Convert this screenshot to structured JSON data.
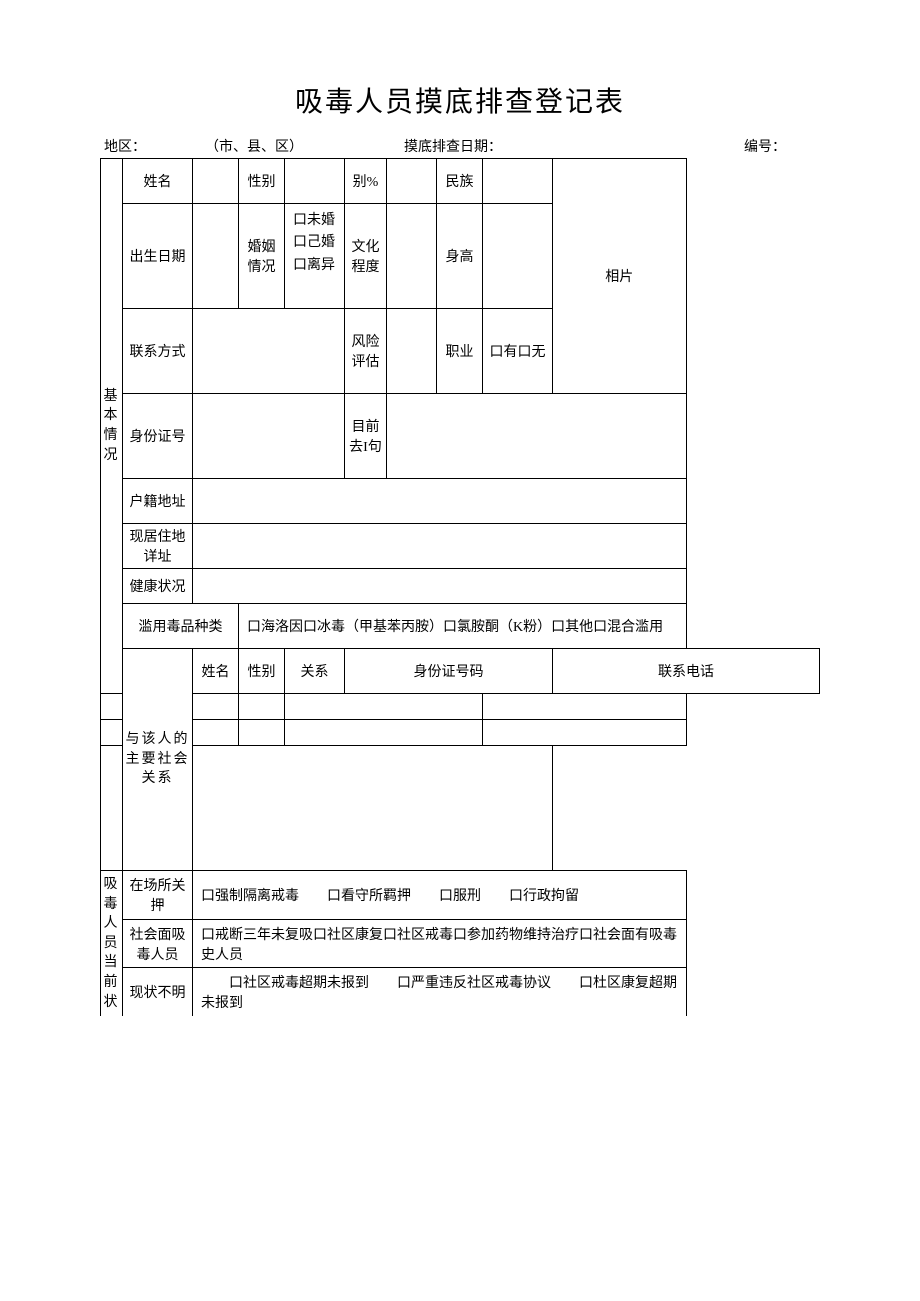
{
  "title": "吸毒人员摸底排查登记表",
  "meta": {
    "region_label": "地区：",
    "region_suffix": "（市、县、区）",
    "date_label": "摸底排查日期：",
    "serial_label": "编号："
  },
  "sections": {
    "basic": "基本情况",
    "relations": "与该人的主要社会关系",
    "status": "吸毒人员当前状"
  },
  "labels": {
    "name": "姓名",
    "sex": "性别",
    "ethnic": "民族",
    "extra_pct": "别%",
    "dob": "出生日期",
    "marital": "婚姻情况",
    "edu": "文化程度",
    "height": "身高",
    "contact": "联系方式",
    "risk": "风险评估",
    "occupation": "职业",
    "id_no": "身份证号",
    "whereabouts": "目前去I句",
    "hukou": "户籍地址",
    "address": "现居住地详址",
    "health": "健康状况",
    "drug": "滥用毒品种类",
    "photo": "相片",
    "rel_header": {
      "name": "姓名",
      "sex": "性别",
      "relation": "关系",
      "id": "身份证号码",
      "phone": "联系电话"
    },
    "in_custody": "在场所关押",
    "community": "社会面吸毒人员",
    "unknown": "现状不明"
  },
  "options": {
    "marital": "口未婚\n口己婚\n口离异",
    "occupation": "口有口无",
    "drug": "口海洛因口冰毒（甲基苯丙胺）口氯胺酮（K粉）口其他口混合滥用",
    "in_custody": "口强制隔离戒毒  口看守所羁押  口服刑  口行政拘留",
    "community": "口戒断三年未复吸口社区康复口社区戒毒口参加药物维持治疗口社会面有吸毒史人员",
    "unknown": "  口社区戒毒超期未报到  口严重违反社区戒毒协议  口杜区康复超期未报到"
  }
}
